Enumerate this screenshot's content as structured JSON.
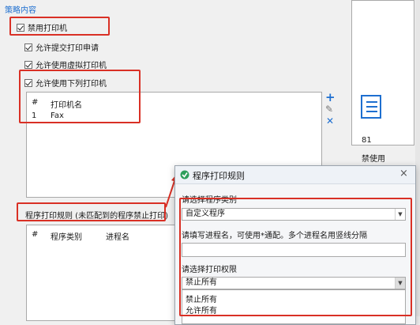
{
  "policy": {
    "heading": "策略内容",
    "disable_printer": "禁用打印机",
    "allow_submit": "允许提交打印申请",
    "allow_virtual": "允许使用虚拟打印机",
    "allow_listed": "允许使用下列打印机"
  },
  "printer_table": {
    "col_num": "#",
    "col_name": "打印机名",
    "rows": [
      {
        "num": "1",
        "name": "Fax"
      }
    ]
  },
  "toolbar": {
    "add_icon": "plus-icon",
    "edit_icon": "pencil-icon",
    "delete_icon": "x-icon"
  },
  "right_panel": {
    "number": "81",
    "text": "禁使用"
  },
  "rules_section": {
    "label": "程序打印规则 (未匹配到的程序禁止打印)",
    "col_num": "#",
    "col_type": "程序类别",
    "col_proc": "进程名"
  },
  "dialog": {
    "title": "程序打印规则",
    "label_type": "请选择程序类别",
    "type_value": "自定义程序",
    "label_process": "请填写进程名，可使用*通配。多个进程名用竖线分隔",
    "process_value": "",
    "label_permission": "请选择打印权限",
    "permission_value": "禁止所有",
    "options": [
      "禁止所有",
      "允许所有"
    ],
    "close": "×"
  },
  "colors": {
    "accent": "#1e6fd0",
    "highlight": "#d93025"
  }
}
